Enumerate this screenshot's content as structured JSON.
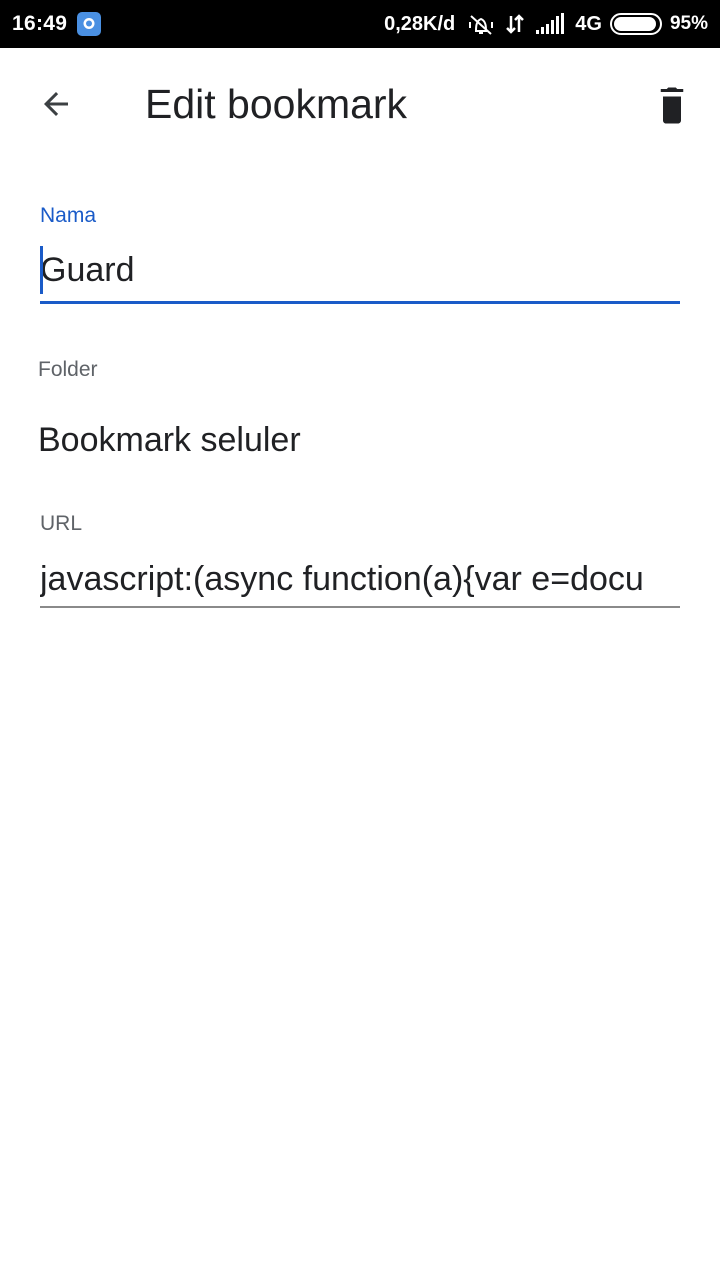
{
  "status_bar": {
    "time": "16:49",
    "speed": "0,28K/d",
    "network": "4G",
    "battery": "95%",
    "battery_level": 0.95,
    "icons": [
      "chat-notification-icon",
      "vibrate-off-icon",
      "data-transfer-icon",
      "signal-icon",
      "battery-icon"
    ]
  },
  "app_bar": {
    "title": "Edit bookmark",
    "back_icon": "arrow-back-icon",
    "delete_icon": "trash-icon"
  },
  "form": {
    "name_label": "Nama",
    "name_value": "Guard",
    "folder_label": "Folder",
    "folder_value": "Bookmark seluler",
    "url_label": "URL",
    "url_value": "javascript:(async function(a){var e=docu"
  },
  "colors": {
    "accent": "#1a5bc8",
    "status_bar": "#000000",
    "text": "#202124",
    "label": "#5f6368"
  }
}
